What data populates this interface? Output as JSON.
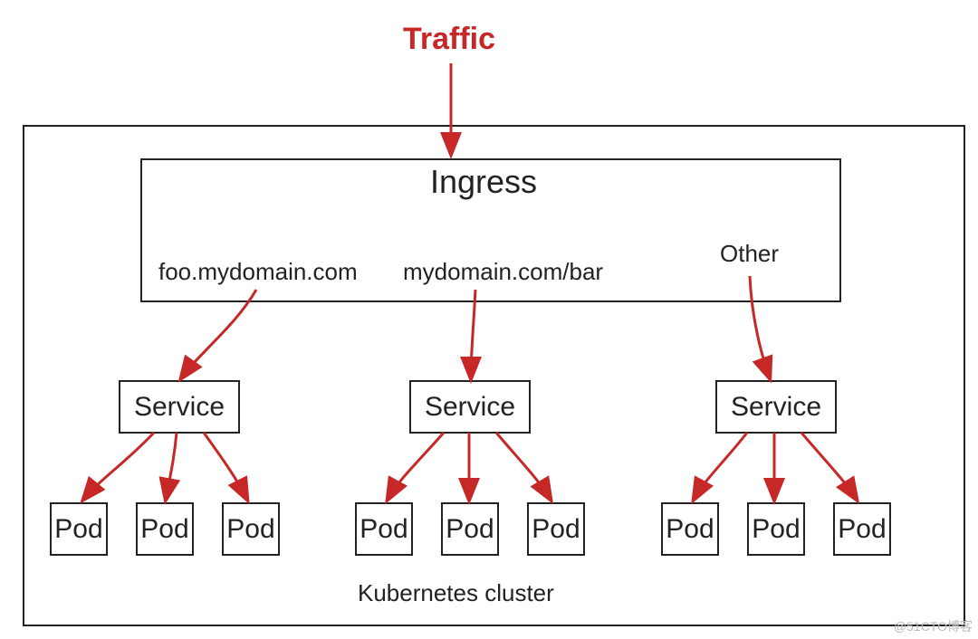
{
  "traffic_label": "Traffic",
  "ingress": {
    "title": "Ingress",
    "routes": {
      "route1": "foo.mydomain.com",
      "route2": "mydomain.com/bar",
      "route3": "Other"
    }
  },
  "services": {
    "s1": {
      "label": "Service",
      "pods": [
        "Pod",
        "Pod",
        "Pod"
      ]
    },
    "s2": {
      "label": "Service",
      "pods": [
        "Pod",
        "Pod",
        "Pod"
      ]
    },
    "s3": {
      "label": "Service",
      "pods": [
        "Pod",
        "Pod",
        "Pod"
      ]
    }
  },
  "cluster_label": "Kubernetes cluster",
  "watermark": "@51CTO博客",
  "colors": {
    "arrow": "#c62828",
    "line": "#222222"
  }
}
